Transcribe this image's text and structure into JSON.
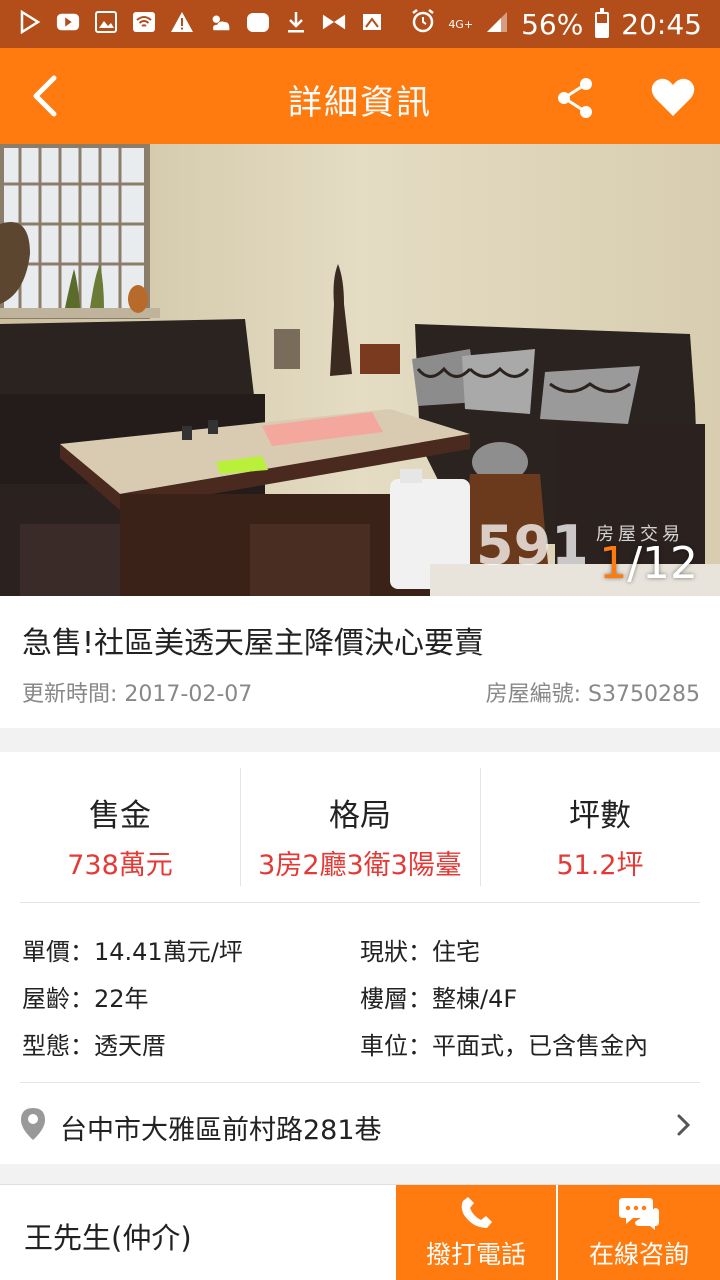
{
  "status_bar": {
    "battery": "56%",
    "time": "20:45",
    "network": "4G+",
    "battery_level": 0.56
  },
  "header": {
    "title": "詳細資訊"
  },
  "gallery": {
    "current": "1",
    "total": "/12",
    "watermark": "591",
    "watermark_sub": "房屋交易"
  },
  "listing": {
    "title": "急售!社區美透天屋主降價決心要賣",
    "update_time": "更新時間: 2017-02-07",
    "house_id": "房屋編號: S3750285"
  },
  "stats": [
    {
      "label": "售金",
      "value": "738萬元"
    },
    {
      "label": "格局",
      "value": "3房2廳3衛3陽臺"
    },
    {
      "label": "坪數",
      "value": "51.2坪"
    }
  ],
  "details": {
    "unit_price": "單價：14.41萬元/坪",
    "status": "現狀：住宅",
    "age": "屋齡：22年",
    "floor": "樓層：整棟/4F",
    "type": "型態：透天厝",
    "parking": "車位：平面式，已含售金內"
  },
  "address": "台中市大雅區前村路281巷",
  "bottom": {
    "agent": "王先生(仲介)",
    "call_label": "撥打電話",
    "chat_label": "在線咨詢"
  },
  "colors": {
    "primary": "#ff7b0f",
    "status_bar": "#b34e1a",
    "price": "#e53935"
  }
}
